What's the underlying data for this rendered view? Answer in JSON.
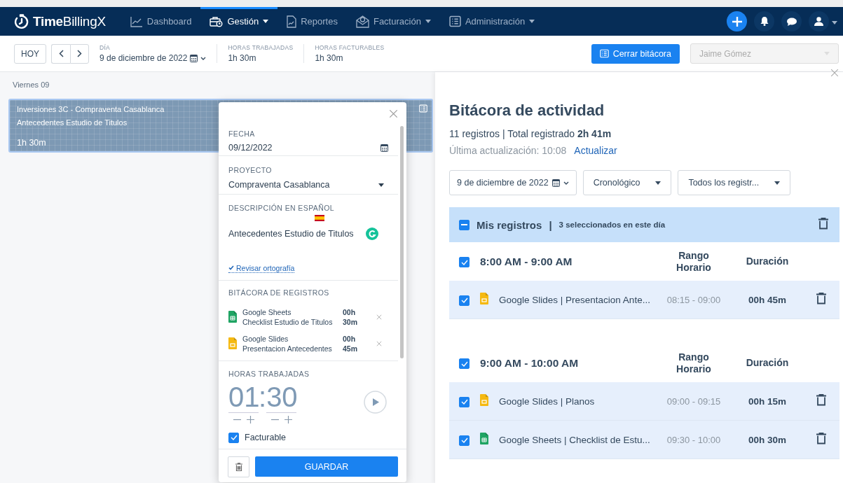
{
  "nav": {
    "brand": "**Time**BillingX",
    "items": [
      {
        "label": "Dashboard",
        "selected": false,
        "dropdown": false
      },
      {
        "label": "Gestión",
        "selected": true,
        "dropdown": true
      },
      {
        "label": "Reportes",
        "selected": false,
        "dropdown": false
      },
      {
        "label": "Facturación",
        "selected": false,
        "dropdown": true
      },
      {
        "label": "Administración",
        "selected": false,
        "dropdown": true
      }
    ]
  },
  "toolbar": {
    "today_button": "HOY",
    "day": {
      "label": "DÍA",
      "value": "9 de diciembre de 2022"
    },
    "stats": [
      {
        "label": "HORAS TRABAJADAS",
        "value": "1h 30m"
      },
      {
        "label": "HORAS FACTURABLES",
        "value": "1h 30m"
      }
    ],
    "close_log_button": "Cerrar bitácora",
    "user_select": {
      "value": "Jaime Gómez",
      "disabled": true
    }
  },
  "calendar": {
    "day_label": "Viernes 09",
    "event": {
      "title": "Inversiones 3C - Compraventa Casablanca",
      "description": "Antecedentes Estudio de Titulos",
      "duration": "1h 30m",
      "selected": true
    }
  },
  "popup": {
    "date": {
      "label": "FECHA",
      "value": "09/12/2022"
    },
    "project": {
      "label": "PROYECTO",
      "value": "Compraventa Casablanca"
    },
    "description": {
      "label": "DESCRIPCIÓN EN ESPAÑOL",
      "value": "Antecedentes Estudio de Titulos"
    },
    "spellcheck_link": "Revisar ortografía",
    "log": {
      "label": "BITÁCORA DE REGISTROS",
      "items": [
        {
          "kind": "sheets",
          "app": "Google Sheets",
          "detail": "Checklist Estudio de Titulos",
          "hours": "00h",
          "minutes": "30m"
        },
        {
          "kind": "slides",
          "app": "Google Slides",
          "detail": "Presentacion Antecedentes",
          "hours": "00h",
          "minutes": "45m"
        }
      ]
    },
    "hours": {
      "label": "HORAS TRABAJADAS",
      "hours": "01",
      "separator": ":",
      "minutes": "30"
    },
    "billable": {
      "label": "Facturable",
      "checked": true
    },
    "save_button": "GUARDAR"
  },
  "activity": {
    "title": "Bitácora de actividad",
    "summary": "11 registros | Total registrado **2h 41m**",
    "last_update": "Última actualización: 10:08",
    "refresh_link": "Actualizar",
    "filters": [
      {
        "kind": "date",
        "value": "9 de diciembre de 2022"
      },
      {
        "kind": "select",
        "value": "Cronológico"
      },
      {
        "kind": "select",
        "value": "Todos los registr..."
      }
    ],
    "group": {
      "title": "Mis registros",
      "separator": "|",
      "note": "3 seleccionados en este día",
      "indeterminate": true
    },
    "slots": [
      {
        "range": "8:00 AM - 9:00 AM",
        "checked": true,
        "range_header": "Rango Horario",
        "duration_header": "Duración",
        "entries": [
          {
            "kind": "slides",
            "text": "Google Slides | Presentacion Ante...",
            "range": "08:15 - 09:00",
            "duration": "00h 45m",
            "checked": true
          }
        ]
      },
      {
        "range": "9:00 AM - 10:00 AM",
        "checked": true,
        "range_header": "Rango Horario",
        "duration_header": "Duración",
        "entries": [
          {
            "kind": "slides",
            "text": "Google Slides | Planos",
            "range": "09:00 - 09:15",
            "duration": "00h 15m",
            "checked": true
          },
          {
            "kind": "sheets",
            "text": "Google Sheets | Checklist de Estu...",
            "range": "09:30 - 10:00",
            "duration": "00h 30m",
            "checked": true
          }
        ]
      }
    ]
  }
}
